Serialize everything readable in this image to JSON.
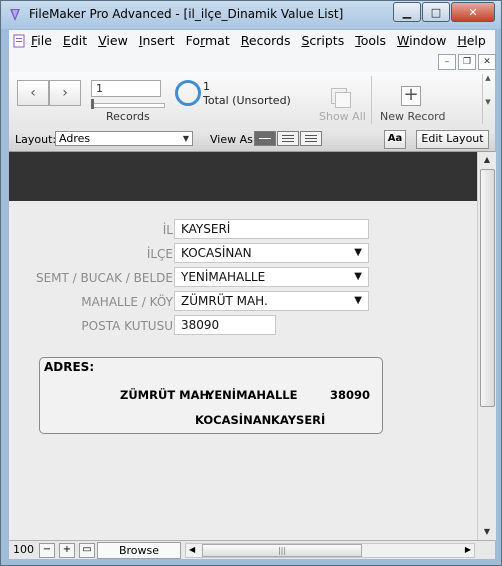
{
  "window": {
    "title": "FileMaker Pro Advanced - [il_ilçe_Dinamik Value List]"
  },
  "menu": [
    {
      "u": "F",
      "rest": "ile"
    },
    {
      "u": "E",
      "rest": "dit"
    },
    {
      "u": "V",
      "rest": "iew"
    },
    {
      "u": "I",
      "rest": "nsert"
    },
    {
      "pre": "Fo",
      "u": "r",
      "rest": "mat"
    },
    {
      "u": "R",
      "rest": "ecords"
    },
    {
      "u": "S",
      "rest": "cripts"
    },
    {
      "u": "T",
      "rest": "ools"
    },
    {
      "u": "W",
      "rest": "indow"
    },
    {
      "u": "H",
      "rest": "elp"
    }
  ],
  "toolbar": {
    "record_number": "1",
    "records_label": "Records",
    "found_count": "1",
    "found_status": "Total (Unsorted)",
    "show_all_label": "Show All",
    "new_record_label": "New Record"
  },
  "layout_bar": {
    "layout_label": "Layout:",
    "layout_value": "Adres",
    "view_as_label": "View As:",
    "aa_label": "Aa",
    "edit_layout_label": "Edit Layout"
  },
  "form": {
    "il_label": "İL",
    "il_value": "KAYSERİ",
    "ilce_label": "İLÇE",
    "ilce_value": "KOCASİNAN",
    "semt_label": "SEMT / BUCAK / BELDE",
    "semt_value": "YENİMAHALLE",
    "mahalle_label": "MAHALLE / KÖY",
    "mahalle_value": "ZÜMRÜT MAH.",
    "posta_label": "POSTA KUTUSU",
    "posta_value": "38090"
  },
  "address": {
    "title": "ADRES:",
    "mahalle": "ZÜMRÜT MAH.",
    "semt": "YENİMAHALLE",
    "posta": "38090",
    "ilce": "KOCASİNAN",
    "il": "KAYSERİ"
  },
  "status_bar": {
    "zoom": "100",
    "mode": "Browse"
  }
}
